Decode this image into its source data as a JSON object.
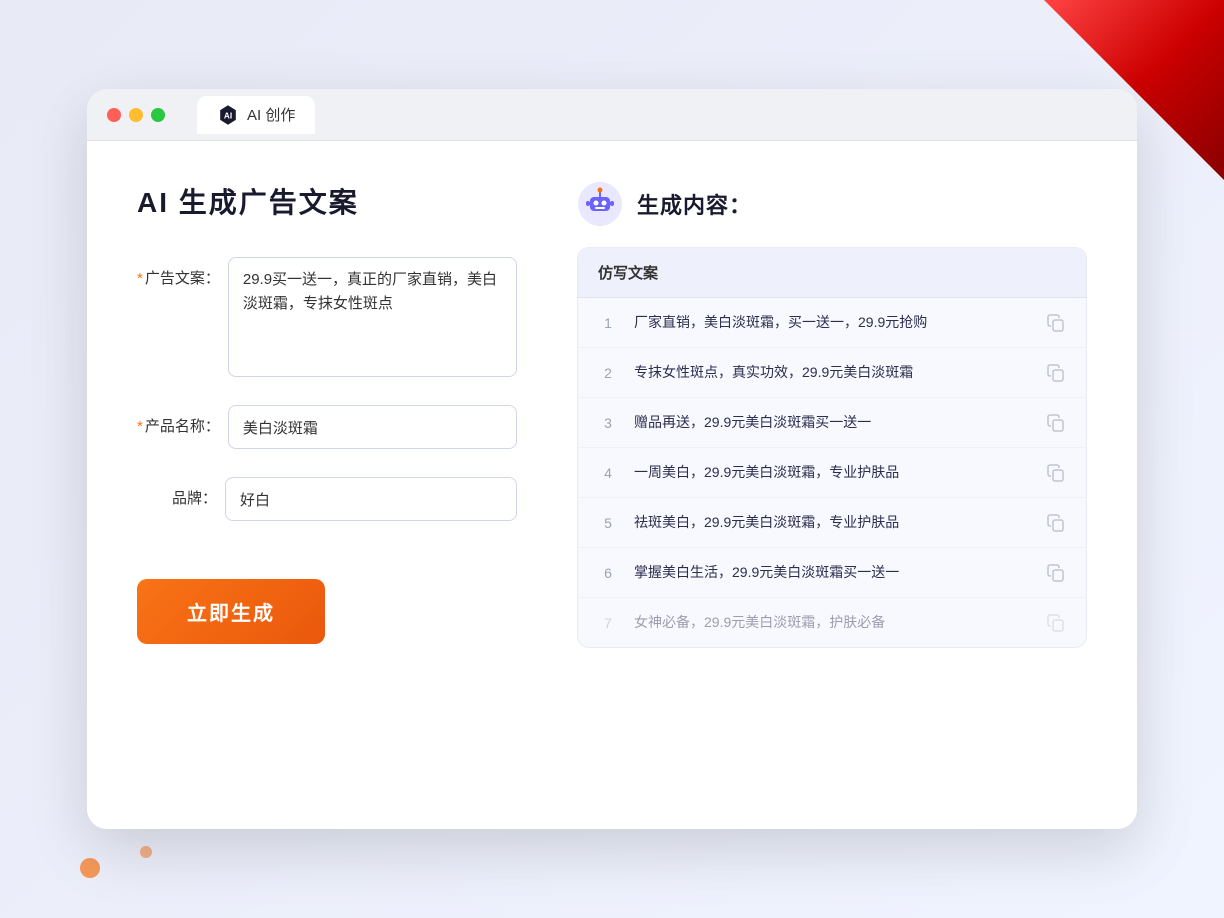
{
  "browser": {
    "tab_label": "AI 创作"
  },
  "page": {
    "title": "AI 生成广告文案",
    "result_title": "生成内容："
  },
  "form": {
    "ad_copy_label": "广告文案：",
    "ad_copy_required": true,
    "ad_copy_value": "29.9买一送一，真正的厂家直销，美白淡斑霜，专抹女性斑点",
    "product_name_label": "产品名称：",
    "product_name_required": true,
    "product_name_value": "美白淡斑霜",
    "brand_label": "品牌：",
    "brand_required": false,
    "brand_value": "好白",
    "generate_btn_label": "立即生成"
  },
  "table": {
    "header": "仿写文案",
    "rows": [
      {
        "num": "1",
        "text": "厂家直销，美白淡斑霜，买一送一，29.9元抢购",
        "faded": false
      },
      {
        "num": "2",
        "text": "专抹女性斑点，真实功效，29.9元美白淡斑霜",
        "faded": false
      },
      {
        "num": "3",
        "text": "赠品再送，29.9元美白淡斑霜买一送一",
        "faded": false
      },
      {
        "num": "4",
        "text": "一周美白，29.9元美白淡斑霜，专业护肤品",
        "faded": false
      },
      {
        "num": "5",
        "text": "祛斑美白，29.9元美白淡斑霜，专业护肤品",
        "faded": false
      },
      {
        "num": "6",
        "text": "掌握美白生活，29.9元美白淡斑霜买一送一",
        "faded": false
      },
      {
        "num": "7",
        "text": "女神必备，29.9元美白淡斑霜，护肤必备",
        "faded": true
      }
    ]
  }
}
